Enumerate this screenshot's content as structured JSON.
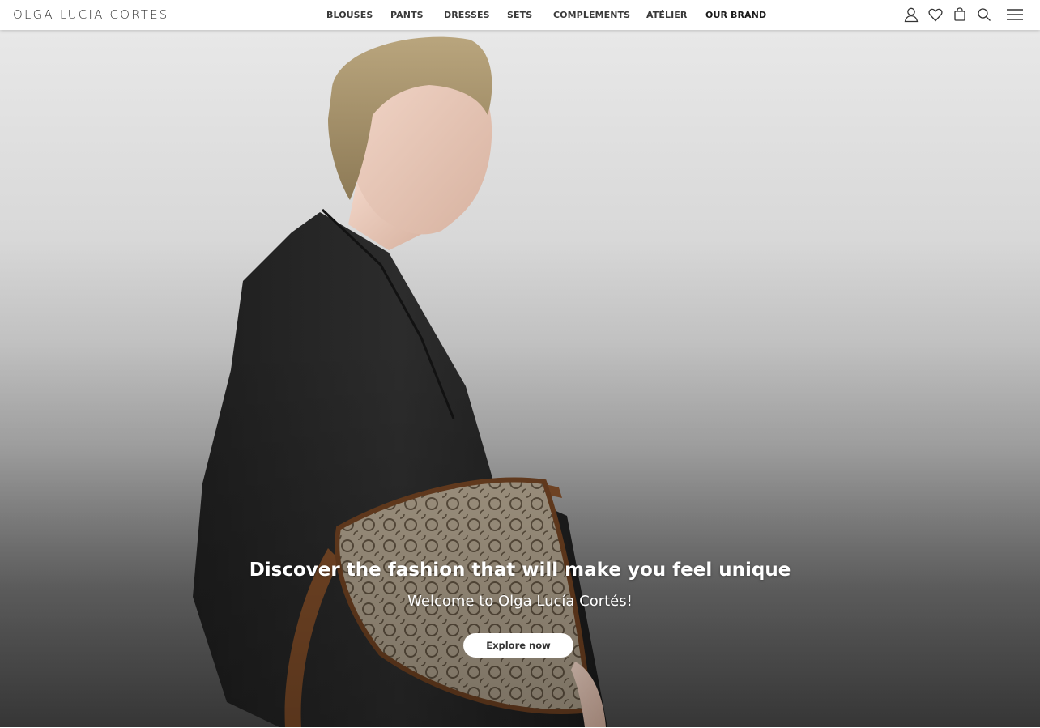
{
  "header": {
    "logo": "OLGA LUCIA CORTES",
    "nav": [
      {
        "label": "BLOUSES"
      },
      {
        "label": "PANTS"
      },
      {
        "label": "DRESSES"
      },
      {
        "label": "SETS"
      },
      {
        "label": "COMPLEMENTS"
      },
      {
        "label": "ATÉLIER"
      },
      {
        "label": "OUR BRAND"
      }
    ],
    "icons": [
      "user-icon",
      "heart-icon",
      "bag-icon",
      "search-icon",
      "menu-icon"
    ]
  },
  "hero": {
    "title": "Discover the fashion that will make you feel unique",
    "subtitle": "Welcome to Olga Lucía Cortés!",
    "cta_label": "Explore now"
  },
  "colors": {
    "header_bg": "#ffffff",
    "text_dark": "#333333",
    "hero_text": "#ffffff",
    "cta_bg": "#ffffff"
  }
}
